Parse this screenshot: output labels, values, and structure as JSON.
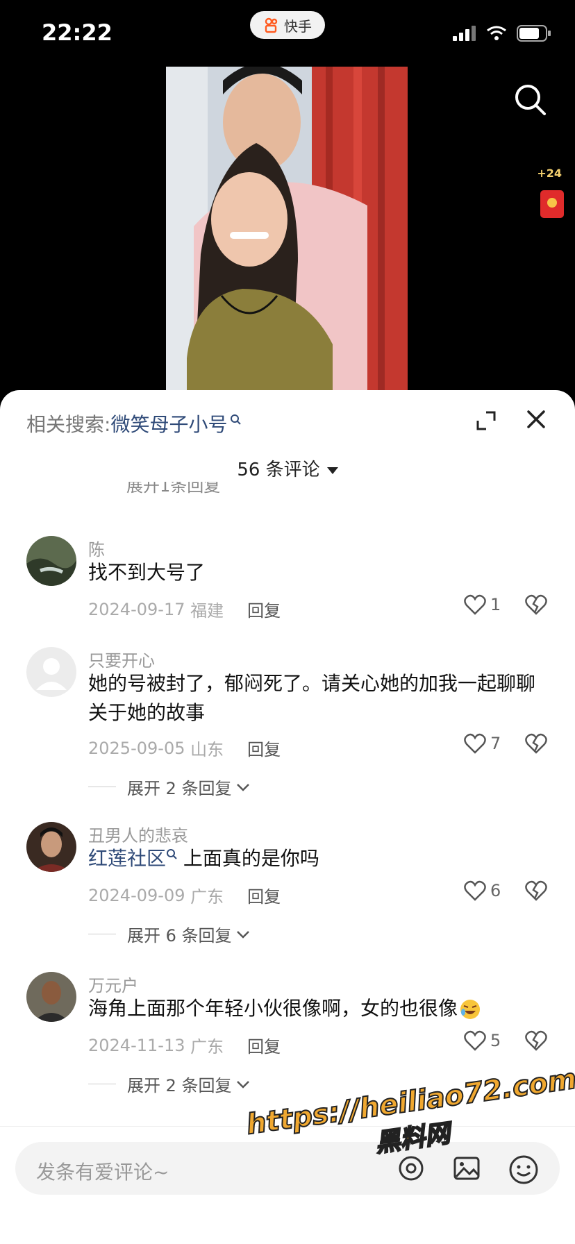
{
  "status_bar": {
    "time": "22:22",
    "app_name": "快手"
  },
  "rewards": {
    "coins": "+24"
  },
  "sheet": {
    "related_label": "相关搜索:",
    "related_query": "微笑母子小号",
    "comment_count": "56 条评论",
    "partial_expand": "展开1条回复"
  },
  "comments": [
    {
      "user": "陈",
      "text": "找不到大号了",
      "date": "2024-09-17",
      "region": "福建",
      "reply": "回复",
      "likes": "1"
    },
    {
      "user": "只要开心",
      "text": "她的号被封了，郁闷死了。请关心她的加我一起聊聊关于她的故事",
      "date": "2025-09-05",
      "region": "山东",
      "reply": "回复",
      "likes": "7",
      "expand": "展开 2 条回复"
    },
    {
      "user": "丑男人的悲哀",
      "link": "红莲社区",
      "text": "上面真的是你吗",
      "date": "2024-09-09",
      "region": "广东",
      "reply": "回复",
      "likes": "6",
      "expand": "展开 6 条回复"
    },
    {
      "user": "万元户",
      "text": "海角上面那个年轻小伙很像啊，女的也很像",
      "date": "2024-11-13",
      "region": "广东",
      "reply": "回复",
      "likes": "5",
      "expand": "展开 2 条回复"
    }
  ],
  "input": {
    "placeholder": "发条有爱评论~"
  },
  "watermark": {
    "line1": "https://heiliao72.com",
    "line2": "黑料网"
  }
}
